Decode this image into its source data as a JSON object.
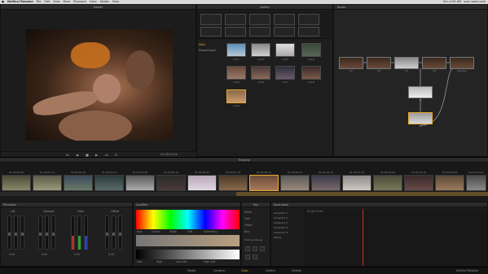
{
  "menubar": {
    "app": "DaVinci Resolve",
    "items": [
      "File",
      "Edit",
      "View",
      "Mark",
      "Playback",
      "Color",
      "Nodes",
      "Help"
    ],
    "clock": "Sun 4:35 AM",
    "user": "user.name.com"
  },
  "viewer": {
    "title": "Viewer",
    "timecode": "01:00:12:04"
  },
  "gallery": {
    "title": "Gallery",
    "tree": [
      "Stills",
      "PowerGrade"
    ],
    "stills": [
      "1.0.1",
      "1.0.2",
      "1.0.3",
      "1.0.4",
      "1.0.5",
      "1.0.6",
      "1.0.7",
      "1.0.8",
      "1.0.9"
    ]
  },
  "nodes": {
    "title": "Nodes",
    "labels": [
      "01",
      "02",
      "03",
      "04",
      "05",
      "06",
      "Parallel",
      "08"
    ]
  },
  "timeline": {
    "title": "Timeline",
    "clips": [
      "01:00:00:00",
      "01:00:01:11",
      "01:00:02:16",
      "01:00:03:14",
      "01:00:04:20",
      "01:00:05:19",
      "01:00:06:22",
      "01:00:07:18",
      "01:00:08:11",
      "01:00:09:14",
      "01:00:10:13",
      "01:00:11:16",
      "01:00:12:04",
      "01:00:13:10",
      "01:00:14:09",
      "01:00:15:13"
    ]
  },
  "primaries": {
    "title": "Primaries",
    "groups": [
      "Lift",
      "Gamma",
      "Gain",
      "Offset"
    ],
    "values": [
      "0.00",
      "0.00",
      "0.00",
      "0.00"
    ]
  },
  "qualifier": {
    "title": "Qualifier",
    "labels": [
      "Hue",
      "Center",
      "Width",
      "Soft",
      "Symmetry",
      "Low",
      "High",
      "Low Soft",
      "High Soft"
    ]
  },
  "key": {
    "title": "Key",
    "labels": [
      "Mode",
      "Gain",
      "Offset",
      "Blur",
      "Shadows Range"
    ]
  },
  "keyframes": {
    "title": "Keyframes",
    "tracks": [
      "Corrector 1",
      "Corrector 2",
      "Corrector 3",
      "Corrector 4",
      "Corrector 5",
      "Sizing"
    ],
    "timecode": "01:00:12:04"
  },
  "bottom": {
    "pages": [
      "Media",
      "Conform",
      "Color",
      "Gallery",
      "Deliver"
    ],
    "app_name": "DaVinci Resolve"
  }
}
